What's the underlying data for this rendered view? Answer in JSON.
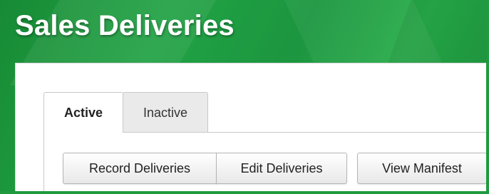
{
  "header": {
    "title": "Sales Deliveries"
  },
  "tabs": [
    {
      "label": "Active",
      "selected": true
    },
    {
      "label": "Inactive",
      "selected": false
    }
  ],
  "toolbar": {
    "record_label": "Record Deliveries",
    "edit_label": "Edit Deliveries",
    "manifest_label": "View Manifest"
  },
  "colors": {
    "brand_green": "#1f9a3f",
    "panel_bg": "#ffffff",
    "tab_inactive_bg": "#eaeaea"
  }
}
